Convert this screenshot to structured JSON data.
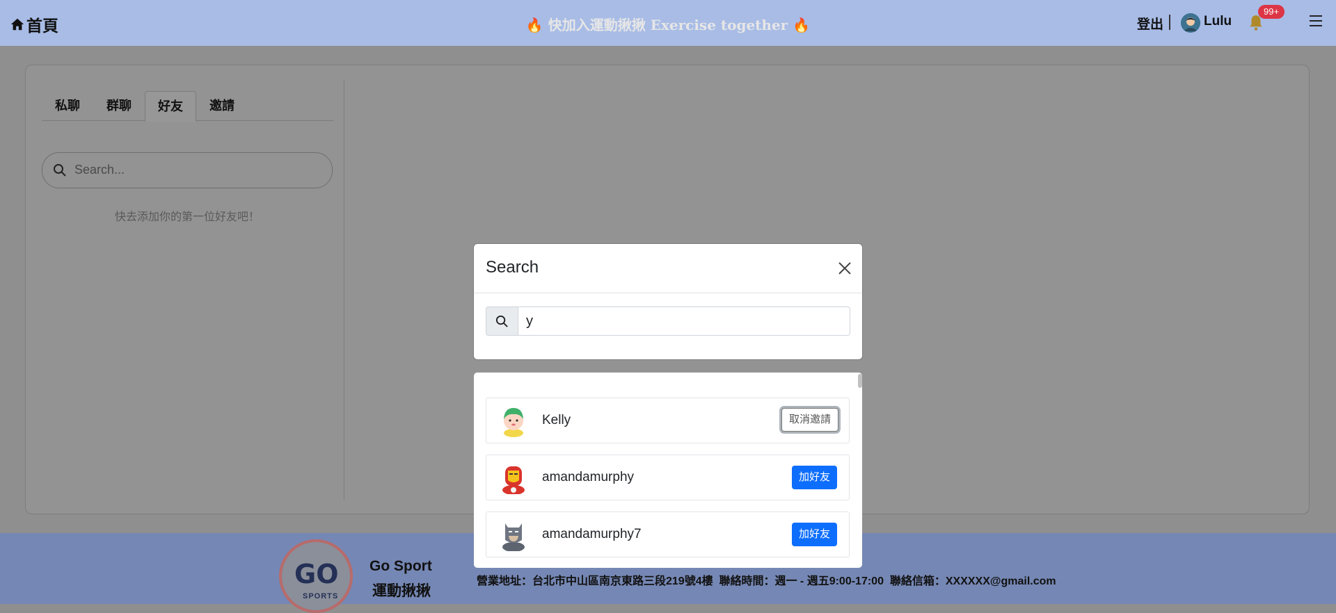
{
  "navbar": {
    "home_label": "首頁",
    "banner_fire": "🔥",
    "banner_text": "快加入運動揪揪 Exercise together",
    "logout_label": "登出",
    "username": "Lulu",
    "notification_badge": "99+"
  },
  "sidebar": {
    "tabs": [
      "私聊",
      "群聊",
      "好友",
      "邀請"
    ],
    "active_tab": "好友",
    "search_placeholder": "Search...",
    "empty_message": "快去添加你的第一位好友吧！"
  },
  "search_modal": {
    "title": "Search",
    "query": "y"
  },
  "results": [
    {
      "name": "Kelly",
      "action": "取消邀請",
      "avatar": "girl-avatar-icon"
    },
    {
      "name": "amandamurphy",
      "action": "加好友",
      "avatar": "ironman-avatar-icon"
    },
    {
      "name": "amandamurphy7",
      "action": "加好友",
      "avatar": "batman-avatar-icon"
    }
  ],
  "footer": {
    "logo_text": "GO",
    "logo_sub": "SPORTS",
    "brand_name": "Go Sport",
    "brand_name_zh": "運動揪揪",
    "info": "營業地址：台北市中山區南京東路三段219號4樓  聯絡時間：週一 - 週五9:00-17:00  聯絡信箱：XXXXXX@gmail.com"
  },
  "colors": {
    "navbar_bg": "#a8bce6",
    "footer_bg": "#7587b4",
    "primary_button": "#0d6efd",
    "badge": "#dc3545"
  }
}
